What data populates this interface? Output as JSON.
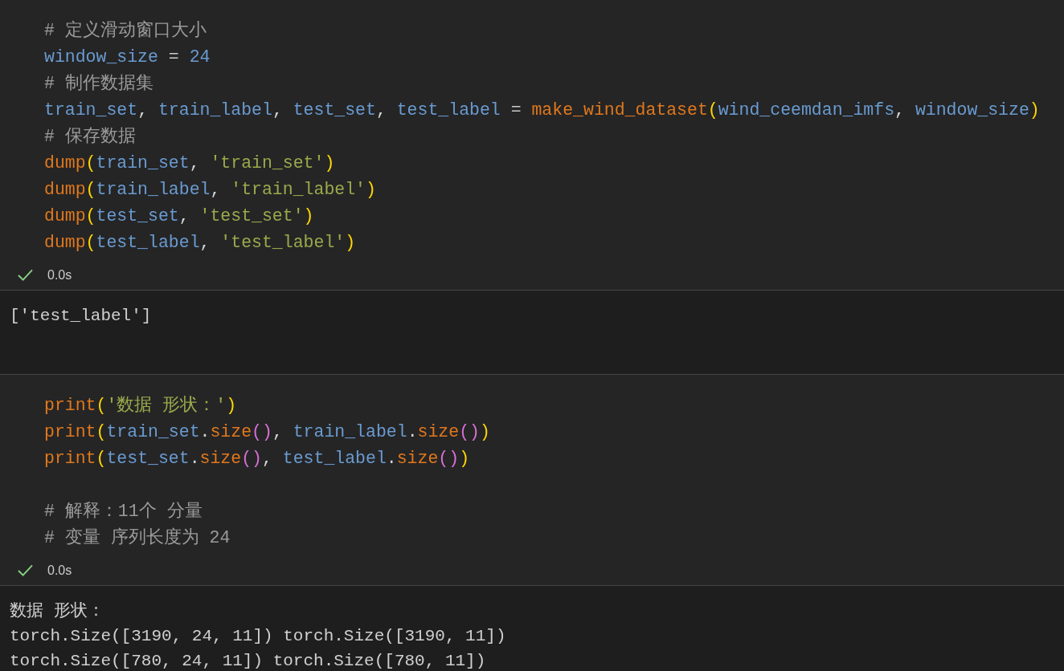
{
  "cells": [
    {
      "code": [
        {
          "kind": "code",
          "tokens": [
            {
              "kind": "comment",
              "text": "# 定义滑动窗口大小"
            }
          ]
        },
        {
          "kind": "code",
          "tokens": [
            {
              "kind": "var",
              "text": "window_size"
            },
            {
              "kind": "op",
              "text": " = "
            },
            {
              "kind": "number",
              "text": "24"
            }
          ]
        },
        {
          "kind": "code",
          "tokens": [
            {
              "kind": "comment",
              "text": "# 制作数据集"
            }
          ]
        },
        {
          "kind": "code",
          "tokens": [
            {
              "kind": "var",
              "text": "train_set"
            },
            {
              "kind": "plain",
              "text": ", "
            },
            {
              "kind": "var",
              "text": "train_label"
            },
            {
              "kind": "plain",
              "text": ", "
            },
            {
              "kind": "var",
              "text": "test_set"
            },
            {
              "kind": "plain",
              "text": ", "
            },
            {
              "kind": "var",
              "text": "test_label"
            },
            {
              "kind": "op",
              "text": " = "
            },
            {
              "kind": "func",
              "text": "make_wind_dataset"
            },
            {
              "kind": "paren1",
              "text": "("
            },
            {
              "kind": "var",
              "text": "wind_ceemdan_imfs"
            },
            {
              "kind": "plain",
              "text": ", "
            },
            {
              "kind": "var",
              "text": "window_size"
            },
            {
              "kind": "paren1",
              "text": ")"
            }
          ]
        },
        {
          "kind": "code",
          "tokens": [
            {
              "kind": "comment",
              "text": "# 保存数据"
            }
          ]
        },
        {
          "kind": "code",
          "tokens": [
            {
              "kind": "func",
              "text": "dump"
            },
            {
              "kind": "paren1",
              "text": "("
            },
            {
              "kind": "var",
              "text": "train_set"
            },
            {
              "kind": "plain",
              "text": ", "
            },
            {
              "kind": "string",
              "text": "'train_set'"
            },
            {
              "kind": "paren1",
              "text": ")"
            }
          ]
        },
        {
          "kind": "code",
          "tokens": [
            {
              "kind": "func",
              "text": "dump"
            },
            {
              "kind": "paren1",
              "text": "("
            },
            {
              "kind": "var",
              "text": "train_label"
            },
            {
              "kind": "plain",
              "text": ", "
            },
            {
              "kind": "string",
              "text": "'train_label'"
            },
            {
              "kind": "paren1",
              "text": ")"
            }
          ]
        },
        {
          "kind": "code",
          "tokens": [
            {
              "kind": "func",
              "text": "dump"
            },
            {
              "kind": "paren1",
              "text": "("
            },
            {
              "kind": "var",
              "text": "test_set"
            },
            {
              "kind": "plain",
              "text": ", "
            },
            {
              "kind": "string",
              "text": "'test_set'"
            },
            {
              "kind": "paren1",
              "text": ")"
            }
          ]
        },
        {
          "kind": "code",
          "tokens": [
            {
              "kind": "func",
              "text": "dump"
            },
            {
              "kind": "paren1",
              "text": "("
            },
            {
              "kind": "var",
              "text": "test_label"
            },
            {
              "kind": "plain",
              "text": ", "
            },
            {
              "kind": "string",
              "text": "'test_label'"
            },
            {
              "kind": "paren1",
              "text": ")"
            }
          ]
        }
      ],
      "status": {
        "kind": "success",
        "time": "0.0s"
      },
      "output": [
        "['test_label']"
      ]
    },
    {
      "code": [
        {
          "kind": "code",
          "tokens": [
            {
              "kind": "func",
              "text": "print"
            },
            {
              "kind": "paren1",
              "text": "("
            },
            {
              "kind": "string",
              "text": "'数据 形状：'"
            },
            {
              "kind": "paren1",
              "text": ")"
            }
          ]
        },
        {
          "kind": "code",
          "tokens": [
            {
              "kind": "func",
              "text": "print"
            },
            {
              "kind": "paren1",
              "text": "("
            },
            {
              "kind": "var",
              "text": "train_set"
            },
            {
              "kind": "plain",
              "text": "."
            },
            {
              "kind": "func",
              "text": "size"
            },
            {
              "kind": "paren2",
              "text": "()"
            },
            {
              "kind": "plain",
              "text": ", "
            },
            {
              "kind": "var",
              "text": "train_label"
            },
            {
              "kind": "plain",
              "text": "."
            },
            {
              "kind": "func",
              "text": "size"
            },
            {
              "kind": "paren2",
              "text": "()"
            },
            {
              "kind": "paren1",
              "text": ")"
            }
          ]
        },
        {
          "kind": "code",
          "tokens": [
            {
              "kind": "func",
              "text": "print"
            },
            {
              "kind": "paren1",
              "text": "("
            },
            {
              "kind": "var",
              "text": "test_set"
            },
            {
              "kind": "plain",
              "text": "."
            },
            {
              "kind": "func",
              "text": "size"
            },
            {
              "kind": "paren2",
              "text": "()"
            },
            {
              "kind": "plain",
              "text": ", "
            },
            {
              "kind": "var",
              "text": "test_label"
            },
            {
              "kind": "plain",
              "text": "."
            },
            {
              "kind": "func",
              "text": "size"
            },
            {
              "kind": "paren2",
              "text": "()"
            },
            {
              "kind": "paren1",
              "text": ")"
            }
          ]
        },
        {
          "kind": "blank"
        },
        {
          "kind": "code",
          "tokens": [
            {
              "kind": "comment",
              "text": "# 解释：11个 分量"
            }
          ]
        },
        {
          "kind": "code",
          "tokens": [
            {
              "kind": "comment",
              "text": "# 变量 序列长度为 24"
            }
          ]
        }
      ],
      "status": {
        "kind": "success",
        "time": "0.0s"
      },
      "output": [
        "数据 形状：",
        "torch.Size([3190, 24, 11]) torch.Size([3190, 11])",
        "torch.Size([780, 24, 11]) torch.Size([780, 11])"
      ]
    }
  ]
}
